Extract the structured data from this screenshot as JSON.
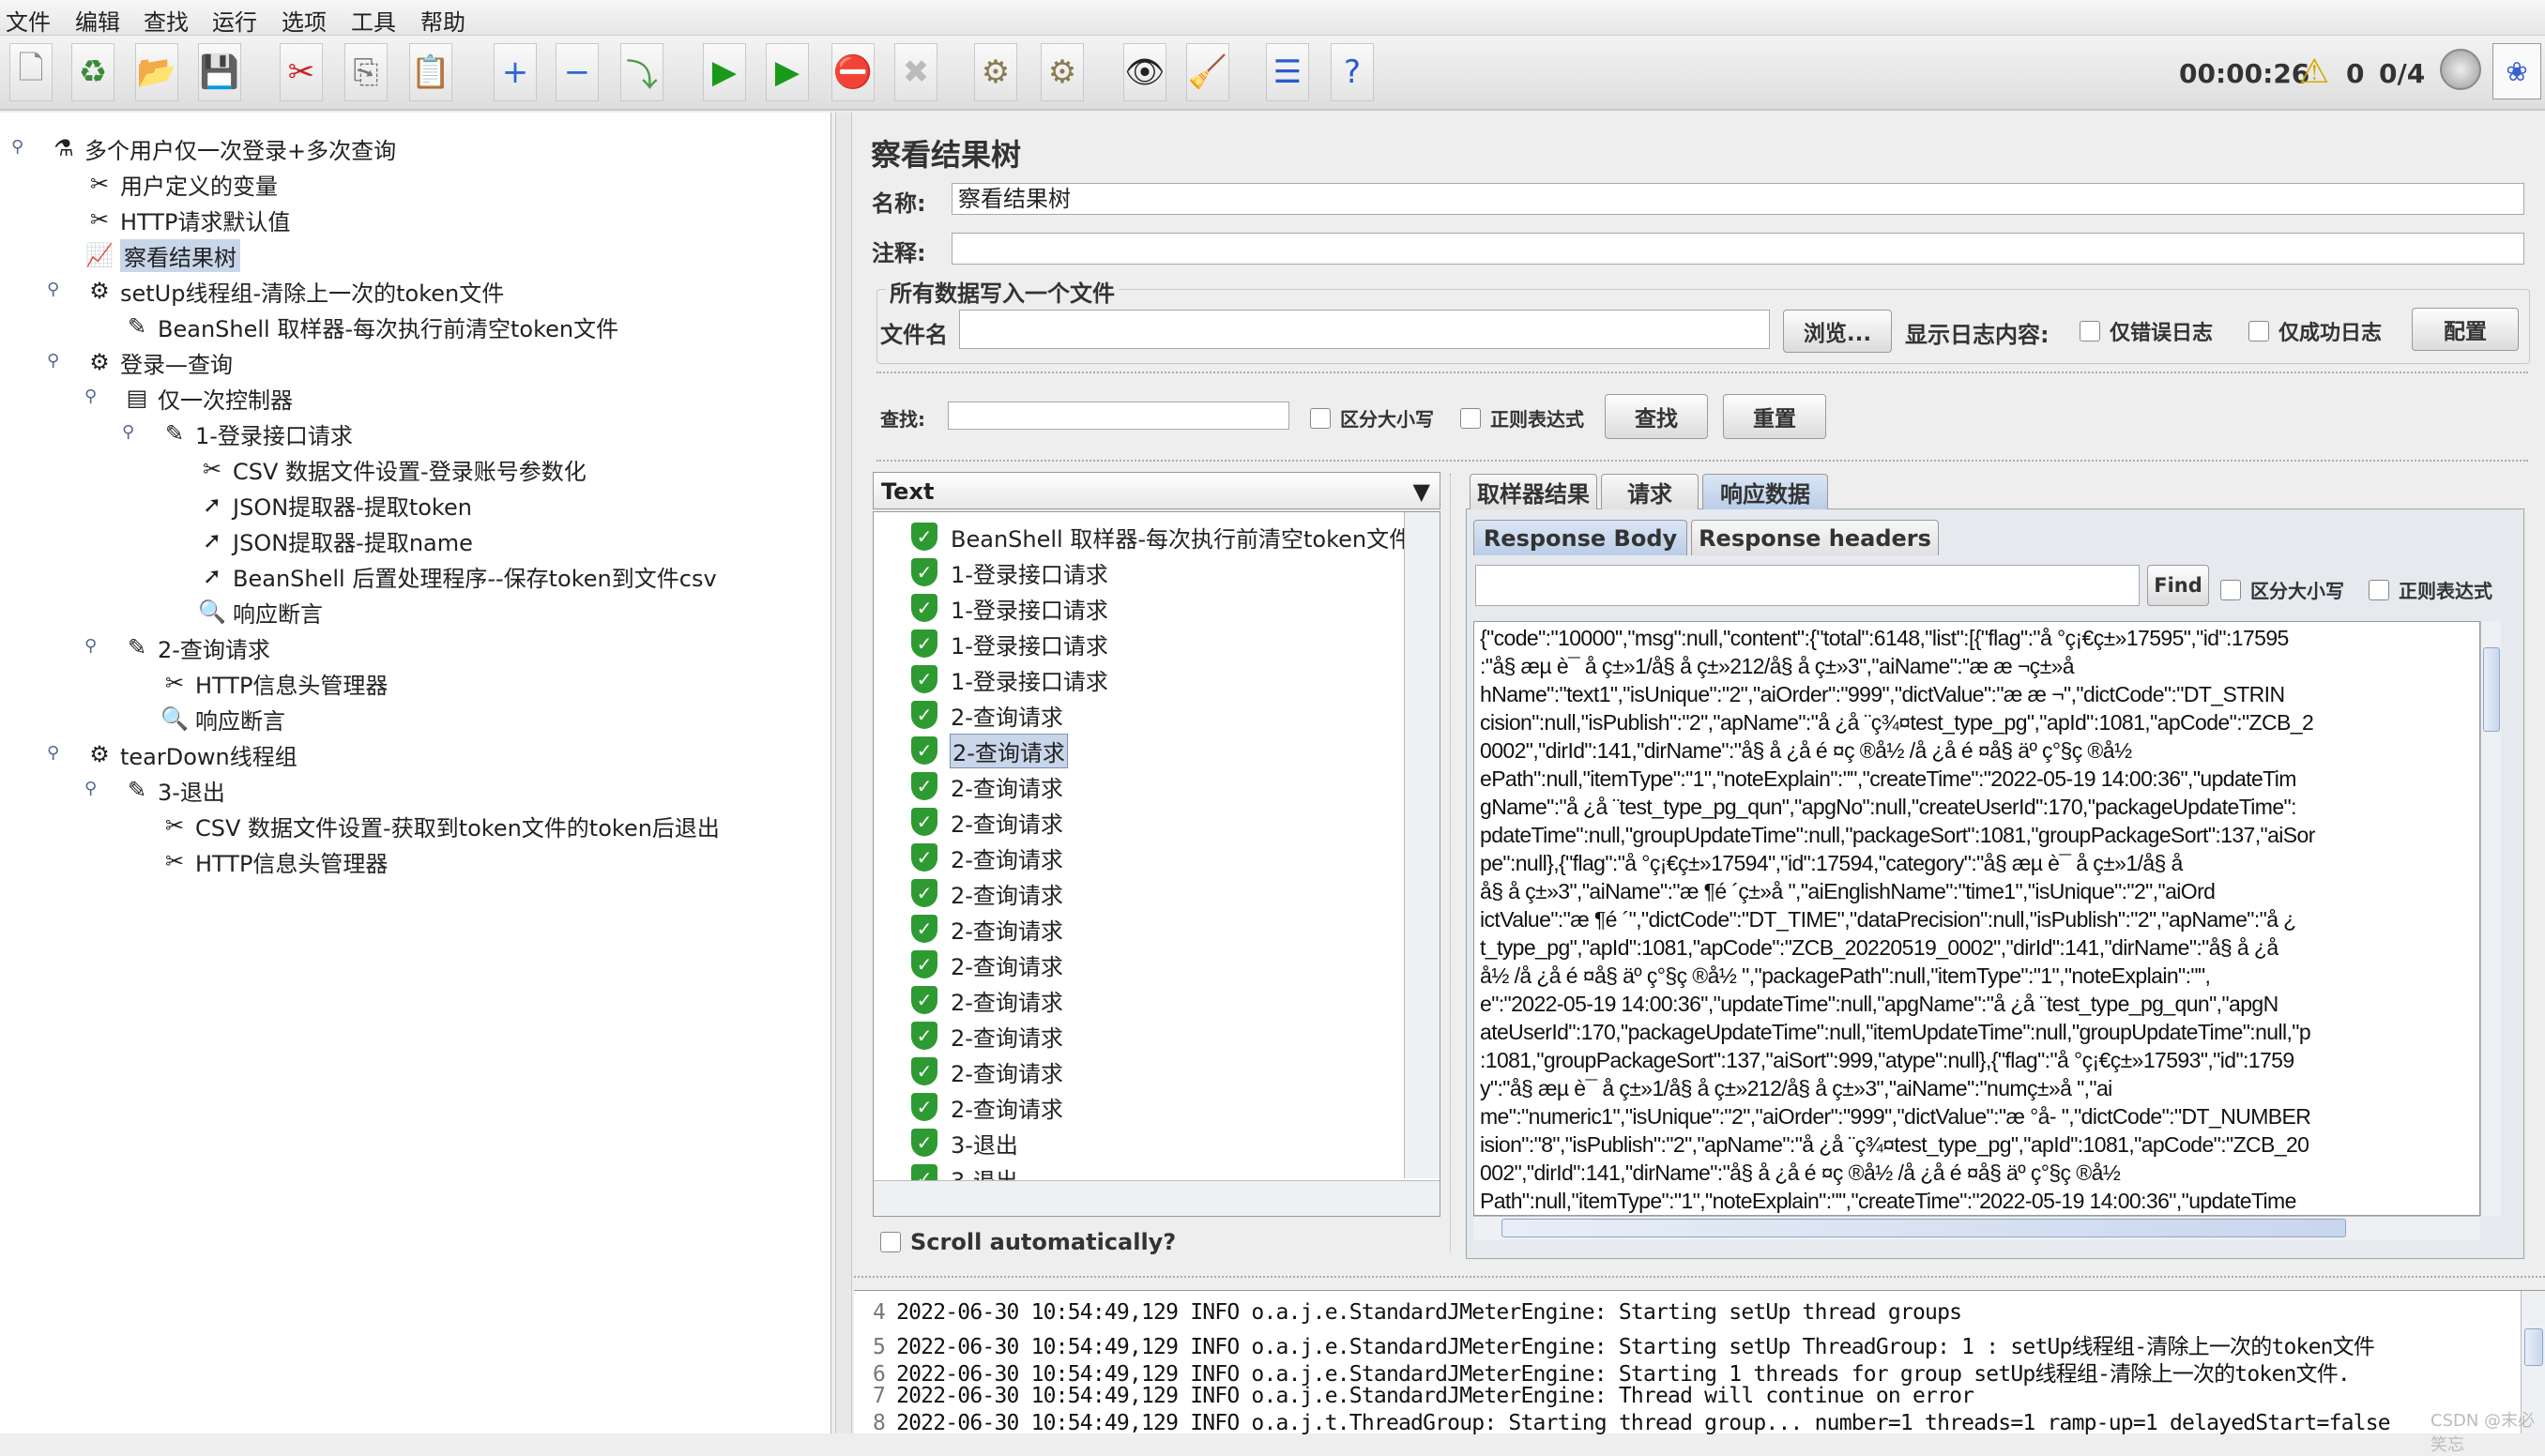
{
  "menu": [
    "文件",
    "编辑",
    "查找",
    "运行",
    "选项",
    "工具",
    "帮助"
  ],
  "toolbar": {
    "icons": [
      "new-icon",
      "templates-icon",
      "open-icon",
      "save-icon",
      "cut-icon",
      "copy-icon",
      "paste-icon",
      "expand-icon",
      "collapse-icon",
      "toggle-icon",
      "start-icon",
      "start-no-pause-icon",
      "stop-icon",
      "shutdown-icon",
      "clear-icon",
      "clear-all-icon",
      "search-icon",
      "reset-search-icon",
      "function-helper-icon",
      "help-icon"
    ],
    "glyphs": [
      "🗋",
      "♻",
      "📂",
      "💾",
      "✂",
      "⎘",
      "📋",
      "+",
      "−",
      "⤵",
      "▶",
      "▶",
      "⛔",
      "✖",
      "⚙",
      "⚙",
      "👁",
      "🧹",
      "☰",
      "?"
    ],
    "timer": "00:00:26",
    "warnings": "0",
    "threads": "0/4"
  },
  "tree": [
    {
      "label": "多个用户仅一次登录+多次查询",
      "level": 0,
      "icon": "test-plan-icon",
      "g": "⚗"
    },
    {
      "label": "用户定义的变量",
      "level": 1,
      "icon": "config-icon",
      "g": "✂"
    },
    {
      "label": "HTTP请求默认值",
      "level": 1,
      "icon": "config-icon",
      "g": "✂"
    },
    {
      "label": "察看结果树",
      "level": 1,
      "icon": "listener-icon",
      "g": "📈",
      "selected": true
    },
    {
      "label": "setUp线程组-清除上一次的token文件",
      "level": 1,
      "icon": "thread-group-icon",
      "g": "⚙"
    },
    {
      "label": "BeanShell 取样器-每次执行前清空token文件",
      "level": 2,
      "icon": "sampler-icon",
      "g": "✎"
    },
    {
      "label": "登录—查询",
      "level": 1,
      "icon": "thread-group-icon",
      "g": "⚙"
    },
    {
      "label": "仅一次控制器",
      "level": 2,
      "icon": "controller-icon",
      "g": "▤"
    },
    {
      "label": "1-登录接口请求",
      "level": 3,
      "icon": "sampler-icon",
      "g": "✎"
    },
    {
      "label": "CSV 数据文件设置-登录账号参数化",
      "level": 4,
      "icon": "config-icon",
      "g": "✂"
    },
    {
      "label": "JSON提取器-提取token",
      "level": 4,
      "icon": "post-processor-icon",
      "g": "➚"
    },
    {
      "label": "JSON提取器-提取name",
      "level": 4,
      "icon": "post-processor-icon",
      "g": "➚"
    },
    {
      "label": "BeanShell 后置处理程序--保存token到文件csv",
      "level": 4,
      "icon": "post-processor-icon",
      "g": "➚"
    },
    {
      "label": "响应断言",
      "level": 4,
      "icon": "assertion-icon",
      "g": "🔍"
    },
    {
      "label": "2-查询请求",
      "level": 2,
      "icon": "sampler-icon",
      "g": "✎"
    },
    {
      "label": "HTTP信息头管理器",
      "level": 3,
      "icon": "config-icon",
      "g": "✂"
    },
    {
      "label": "响应断言",
      "level": 3,
      "icon": "assertion-icon",
      "g": "🔍"
    },
    {
      "label": "tearDown线程组",
      "level": 1,
      "icon": "thread-group-icon",
      "g": "⚙"
    },
    {
      "label": "3-退出",
      "level": 2,
      "icon": "sampler-icon",
      "g": "✎"
    },
    {
      "label": "CSV 数据文件设置-获取到token文件的token后退出",
      "level": 3,
      "icon": "config-icon",
      "g": "✂"
    },
    {
      "label": "HTTP信息头管理器",
      "level": 3,
      "icon": "config-icon",
      "g": "✂"
    }
  ],
  "panel": {
    "title": "察看结果树",
    "name_label": "名称:",
    "name_value": "察看结果树",
    "comment_label": "注释:",
    "comment_value": "",
    "file_group": "所有数据写入一个文件",
    "file_label": "文件名",
    "file_value": "",
    "browse": "浏览...",
    "log_label": "显示日志内容:",
    "errors_only": "仅错误日志",
    "success_only": "仅成功日志",
    "configure": "配置",
    "search_label": "查找:",
    "search_value": "",
    "case": "区分大小写",
    "regex": "正则表达式",
    "find": "查找",
    "reset": "重置"
  },
  "results": {
    "renderer": "Text",
    "items": [
      "BeanShell 取样器-每次执行前清空token文件",
      "1-登录接口请求",
      "1-登录接口请求",
      "1-登录接口请求",
      "1-登录接口请求",
      "2-查询请求",
      "2-查询请求",
      "2-查询请求",
      "2-查询请求",
      "2-查询请求",
      "2-查询请求",
      "2-查询请求",
      "2-查询请求",
      "2-查询请求",
      "2-查询请求",
      "2-查询请求",
      "2-查询请求",
      "3-退出",
      "3-退出"
    ],
    "selected_index": 6,
    "scroll_auto": "Scroll automatically?"
  },
  "tabs": {
    "main": [
      "取样器结果",
      "请求",
      "响应数据"
    ],
    "main_active": 2,
    "sub": [
      "Response Body",
      "Response headers"
    ],
    "sub_active": 0,
    "find": "Find",
    "case": "区分大小写",
    "regex": "正则表达式",
    "find_value": ""
  },
  "response_lines": [
    "{\"code\":\"10000\",\"msg\":null,\"content\":{\"total\":6148,\"list\":[{\"flag\":\"å   °ç¡€ç±»17595\",\"id\":17595",
    ":\"å§  æµ  è¯  å     ç±»1/å§  å     ç±»212/å§  å     ç±»3\",\"aiName\":\"æ     æ  ¬ç±»å",
    "hName\":\"text1\",\"isUnique\":\"2\",\"aiOrder\":\"999\",\"dictValue\":\"æ      æ  ¬\",\"dictCode\":\"DT_STRIN",
    "cision\":null,\"isPublish\":\"2\",\"apName\":\"å   ¿å   ¨ç¾¤test_type_pg\",\"apId\":1081,\"apCode\":\"ZCB_2",
    "0002\",\"dirId\":141,\"dirName\":\"å§  å  ¿å   é  ¤ç  ®å½  /å  ¿å   é  ¤å§  äº  ç°§ç  ®å½",
    "ePath\":null,\"itemType\":\"1\",\"noteExplain\":\"\",\"createTime\":\"2022-05-19 14:00:36\",\"updateTim",
    "gName\":\"å   ¿å   ¨test_type_pg_qun\",\"apgNo\":null,\"createUserId\":170,\"packageUpdateTime\":",
    "pdateTime\":null,\"groupUpdateTime\":null,\"packageSort\":1081,\"groupPackageSort\":137,\"aiSor",
    "pe\":null},{\"flag\":\"å   °ç¡€ç±»17594\",\"id\":17594,\"category\":\"å§  æµ  è¯  å     ç±»1/å§  å",
    "å§  å     ç±»3\",\"aiName\":\"æ  ¶é  ´ç±»å      \",\"aiEnglishName\":\"time1\",\"isUnique\":\"2\",\"aiOrd",
    "ictValue\":\"æ  ¶é  ´\",\"dictCode\":\"DT_TIME\",\"dataPrecision\":null,\"isPublish\":\"2\",\"apName\":\"å  ¿",
    "t_type_pg\",\"apId\":1081,\"apCode\":\"ZCB_20220519_0002\",\"dirId\":141,\"dirName\":\"å§  å  ¿å",
    "å½  /å  ¿å   é  ¤å§  äº  ç°§ç  ®å½  \",\"packagePath\":null,\"itemType\":\"1\",\"noteExplain\":\"\",",
    "e\":\"2022-05-19 14:00:36\",\"updateTime\":null,\"apgName\":\"å   ¿å   ¨test_type_pg_qun\",\"apgN",
    "ateUserId\":170,\"packageUpdateTime\":null,\"itemUpdateTime\":null,\"groupUpdateTime\":null,\"p",
    ":1081,\"groupPackageSort\":137,\"aiSort\":999,\"atype\":null},{\"flag\":\"å   °ç¡€ç±»17593\",\"id\":1759",
    "y\":\"å§  æµ  è¯  å     ç±»1/å§  å     ç±»212/å§  å     ç±»3\",\"aiName\":\"numç±»å      \",\"ai",
    "me\":\"numeric1\",\"isUnique\":\"2\",\"aiOrder\":\"999\",\"dictValue\":\"æ   °å-   \",\"dictCode\":\"DT_NUMBER",
    "ision\":\"8\",\"isPublish\":\"2\",\"apName\":\"å   ¿å   ¨ç¾¤test_type_pg\",\"apId\":1081,\"apCode\":\"ZCB_20",
    "002\",\"dirId\":141,\"dirName\":\"å§  å  ¿å   é  ¤ç  ®å½  /å  ¿å   é  ¤å§  äº  ç°§ç  ®å½",
    "Path\":null,\"itemType\":\"1\",\"noteExplain\":\"\",\"createTime\":\"2022-05-19 14:00:36\",\"updateTime"
  ],
  "log": [
    {
      "n": "4",
      "text": "2022-06-30 10:54:49,129 INFO o.a.j.e.StandardJMeterEngine: Starting setUp thread groups"
    },
    {
      "n": "5",
      "text": "2022-06-30 10:54:49,129 INFO o.a.j.e.StandardJMeterEngine: Starting setUp ThreadGroup: 1 : setUp线程组-清除上一次的token文件"
    },
    {
      "n": "6",
      "text": "2022-06-30 10:54:49,129 INFO o.a.j.e.StandardJMeterEngine: Starting 1 threads for group setUp线程组-清除上一次的token文件."
    },
    {
      "n": "7",
      "text": "2022-06-30 10:54:49,129 INFO o.a.j.e.StandardJMeterEngine: Thread will continue on error"
    },
    {
      "n": "8",
      "text": "2022-06-30 10:54:49,129 INFO o.a.j.t.ThreadGroup: Starting thread group... number=1 threads=1 ramp-up=1 delayedStart=false"
    }
  ],
  "watermark": "CSDN @末必笑忘"
}
